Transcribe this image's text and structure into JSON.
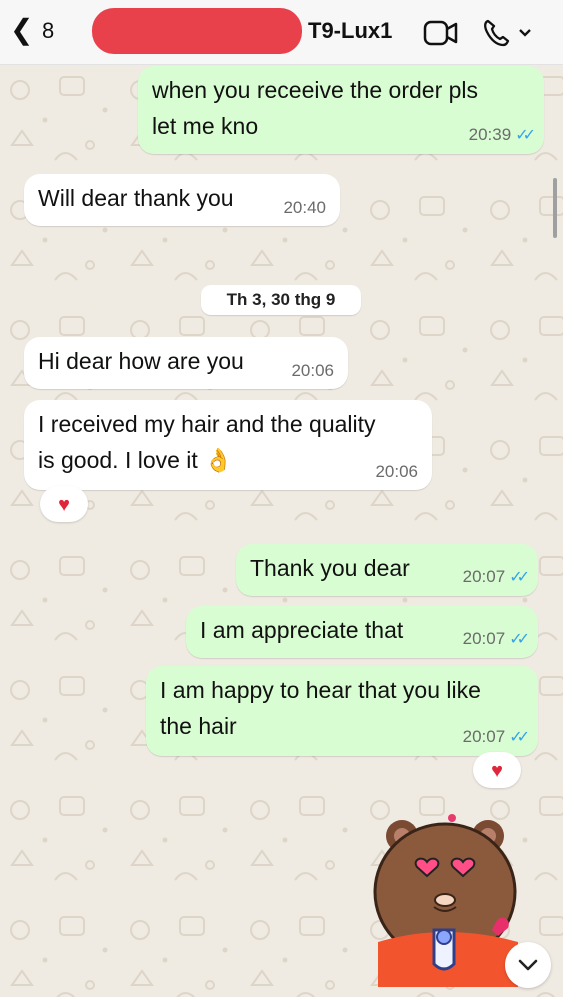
{
  "header": {
    "back_count": "8",
    "contact_name": "T9-Lux1",
    "back_icon": "chevron-left-icon",
    "video_icon": "video-camera-icon",
    "call_icon": "phone-icon"
  },
  "date_separator": "Th 3, 30 thg 9",
  "messages": [
    {
      "text_lines": [
        "when you receeive the order pls",
        "let me kno"
      ],
      "time": "20:39",
      "read_ticks": "✓✓"
    },
    {
      "text_lines": [
        "Will dear thank you"
      ],
      "time": "20:40"
    },
    {
      "text_lines": [
        "Hi dear how are you"
      ],
      "time": "20:06"
    },
    {
      "text_lines": [
        "I received my hair and the quality",
        "is good. I love it"
      ],
      "emoji": "👌",
      "time": "20:06",
      "reaction": "♥"
    },
    {
      "text_lines": [
        "Thank you dear"
      ],
      "time": "20:07",
      "read_ticks": "✓✓"
    },
    {
      "text_lines": [
        "I am appreciate that"
      ],
      "time": "20:07",
      "read_ticks": "✓✓"
    },
    {
      "text_lines": [
        "I am happy to hear that you like",
        "the hair"
      ],
      "time": "20:07",
      "read_ticks": "✓✓",
      "reaction": "♥"
    }
  ],
  "colors": {
    "outgoing_bubble": "#d9fdd3",
    "incoming_bubble": "#ffffff",
    "read_ticks": "#34a3e8",
    "reaction_heart": "#e0263a",
    "redaction": "#e8414b"
  },
  "sticker": "bear-heart-eyes-sticker",
  "scroll_down_icon": "chevron-down-icon"
}
